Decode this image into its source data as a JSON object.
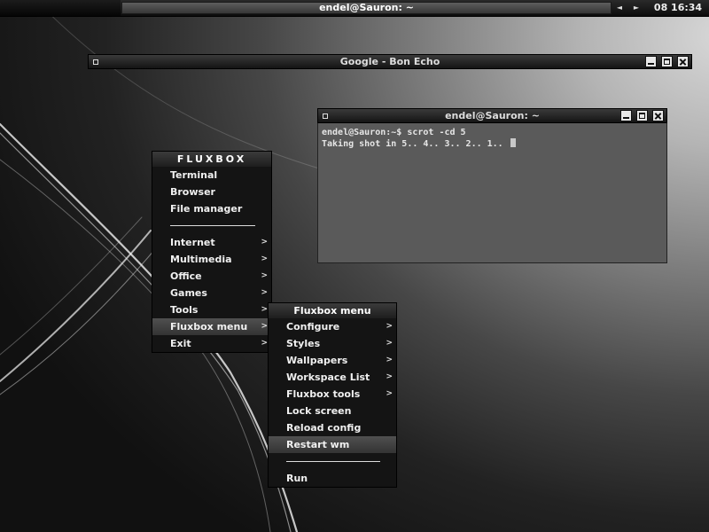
{
  "toolbar": {
    "task_title": "endel@Sauron: ~",
    "prev_workspace_glyph": "◄",
    "next_workspace_glyph": "►",
    "clock": "08 16:34"
  },
  "browser_window": {
    "title": "Google - Bon Echo"
  },
  "terminal_window": {
    "title": "endel@Sauron: ~",
    "lines": [
      "endel@Sauron:~$ scrot -cd 5",
      "Taking shot in 5.. 4.. 3.. 2.. 1.. "
    ]
  },
  "root_menu": {
    "title": "FLUXBOX",
    "items": [
      {
        "label": "Terminal"
      },
      {
        "label": "Browser"
      },
      {
        "label": "File manager"
      },
      {
        "label": "Internet"
      },
      {
        "label": "Multimedia"
      },
      {
        "label": "Office"
      },
      {
        "label": "Games"
      },
      {
        "label": "Tools"
      },
      {
        "label": "Fluxbox menu"
      },
      {
        "label": "Exit"
      }
    ],
    "submenu_glyph": ">"
  },
  "fluxbox_menu": {
    "title": "Fluxbox menu",
    "items": [
      {
        "label": "Configure"
      },
      {
        "label": "Styles"
      },
      {
        "label": "Wallpapers"
      },
      {
        "label": "Workspace List"
      },
      {
        "label": "Fluxbox tools"
      },
      {
        "label": "Lock screen"
      },
      {
        "label": "Reload config"
      },
      {
        "label": "Restart wm"
      },
      {
        "label": "Run"
      }
    ],
    "submenu_glyph": ">"
  },
  "colors": {
    "menu_bg": "#141414",
    "menu_highlight": "#444444",
    "terminal_bg": "#5a5a5a",
    "text": "#f0f0f0"
  }
}
